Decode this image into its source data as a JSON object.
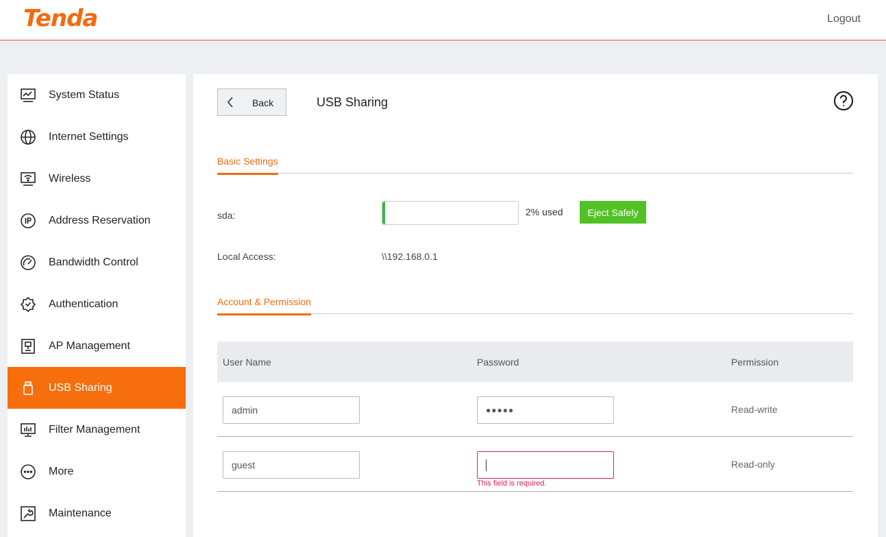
{
  "header": {
    "logo": "Tenda",
    "logout_label": "Logout"
  },
  "sidebar": {
    "items": [
      {
        "label": "System Status",
        "icon": "monitor-chart-icon"
      },
      {
        "label": "Internet Settings",
        "icon": "globe-icon"
      },
      {
        "label": "Wireless",
        "icon": "wifi-screen-icon"
      },
      {
        "label": "Address Reservation",
        "icon": "ip-circle-icon"
      },
      {
        "label": "Bandwidth Control",
        "icon": "gauge-icon"
      },
      {
        "label": "Authentication",
        "icon": "badge-check-icon"
      },
      {
        "label": "AP Management",
        "icon": "ap-device-icon"
      },
      {
        "label": "USB Sharing",
        "icon": "usb-drive-icon",
        "active": true
      },
      {
        "label": "Filter Management",
        "icon": "bar-screen-icon"
      },
      {
        "label": "More",
        "icon": "more-circle-icon"
      },
      {
        "label": "Maintenance",
        "icon": "wrench-icon"
      }
    ]
  },
  "page": {
    "back_label": "Back",
    "title": "USB Sharing"
  },
  "basic": {
    "tab_label": "Basic Settings",
    "sda_label": "sda:",
    "usage_percent": 2,
    "usage_text": "2% used",
    "eject_label": "Eject Safely",
    "local_access_label": "Local Access:",
    "local_access_value": "\\\\192.168.0.1"
  },
  "account": {
    "tab_label": "Account & Permission",
    "columns": [
      "User Name",
      "Password",
      "Permission"
    ],
    "rows": [
      {
        "username": "admin",
        "password": "●●●●●",
        "permission": "Read-write"
      },
      {
        "username": "guest",
        "password": "",
        "permission": "Read-only",
        "error": "This field is required."
      }
    ]
  },
  "colors": {
    "brand": "#f26b0f",
    "active_nav": "#f76e0c",
    "eject": "#52c126",
    "usage": "#3cb54a",
    "error": "#d8234a"
  }
}
